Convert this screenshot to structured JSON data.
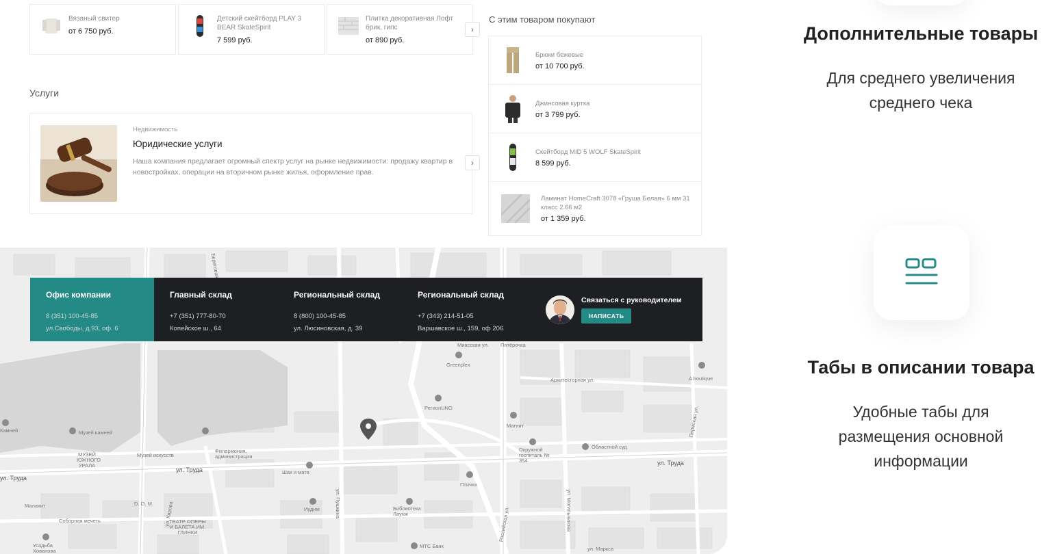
{
  "products": [
    {
      "name": "Вязаный свитер",
      "price": "от 6 750 руб."
    },
    {
      "name": "Детский скейтборд PLAY 3 BEAR SkateSpirit",
      "price": "7 599 руб."
    },
    {
      "name": "Плитка декоративная Лофт брик, гипс",
      "price": "от 890 руб."
    }
  ],
  "arrow": "›",
  "services": {
    "title": "Услуги",
    "card": {
      "category": "Недвижимость",
      "title": "Юридические услуги",
      "description": "Наша компания предлагает огромный спектр услуг на рынке недвижимости: продажу квартир в новостройках, операции на вторичном рынке жилья, оформление прав."
    }
  },
  "related": {
    "title": "С этим товаром покупают",
    "items": [
      {
        "name": "Брюки бежевые",
        "price": "от 10 700 руб."
      },
      {
        "name": "Джинсовая куртка",
        "price": "от 3 799 руб."
      },
      {
        "name": "Скейтборд MID 5 WOLF SkateSpirit",
        "price": "8 599 руб."
      },
      {
        "name": "Ламинат HomeCraft 3078 «Груша Белая» 6 мм 31 класс 2.66 м2",
        "price": "от 1 359 руб."
      }
    ]
  },
  "offices": [
    {
      "title": "Офис компании",
      "phone": "8 (351) 100-45-85",
      "address": "ул.Свободы, д.93, оф. 6",
      "active": true
    },
    {
      "title": "Главный склад",
      "phone": "+7 (351) 777-80-70",
      "address": "Копейское ш., 64"
    },
    {
      "title": "Региональный склад",
      "phone": "8 (800) 100-45-85",
      "address": "ул. Люсиновская, д. 39"
    },
    {
      "title": "Региональный склад",
      "phone": "+7 (343) 214-51-05",
      "address": "Варшавское ш., 159, оф 206"
    }
  ],
  "contact": {
    "title": "Связаться с руководителем",
    "button": "НАПИСАТЬ"
  },
  "map_labels": {
    "l1": "Музей камней",
    "l2": "Музей искусств",
    "l3": "Филармония, администрация",
    "l4": "ул. Труда",
    "l5": "Шах и мата",
    "l6": "Малахит",
    "l7": "Соборная мечеть",
    "l8": "D. O. M.",
    "l9": "ТЕАТР ОПЕРЫ И БАЛЕТА ИМ. ГЛИНКИ",
    "l10": "Иудим",
    "l11": "ул. Пушкина",
    "l12": "Библиотека Лаунж",
    "l13": "МТС Банк",
    "l14": "Птичка",
    "l15": "РегионUNO",
    "l16": "Greenplex",
    "l17": "Миасская ул.",
    "l18": "Пятёрочка",
    "l19": "Архитекторная ул.",
    "l20": "Магнит",
    "l21": "Окружной госпиталь № 354",
    "l22": "Областной суд",
    "l23": "ул. Труда",
    "l24": "A boutique",
    "l25": "ул. Маркса",
    "l26": "Российская ул.",
    "l27": "ул. Могильникова",
    "l28": "Пермская ул.",
    "l29": "МУЗЕЙ ЮЖНОГО УРАЛА",
    "l30": "Камней",
    "l31": "ул. Труда",
    "l32": "Усадьба Хованова",
    "l33": "ул. Кирова",
    "l34": "Береговая"
  },
  "features": [
    {
      "title": "Дополнительные товары",
      "subtitle_1": "Для среднего увеличения",
      "subtitle_2": "среднего чека"
    },
    {
      "title": "Табы в описании товара",
      "subtitle_1": "Удобные табы для",
      "subtitle_2": "размещения основной",
      "subtitle_3": "информации"
    }
  ],
  "colors": {
    "accent": "#238a86",
    "dark_bar": "#1e1f22",
    "map_bg": "#eeeeee"
  },
  "icons": {
    "tabs_feature": "tabs-icon"
  }
}
